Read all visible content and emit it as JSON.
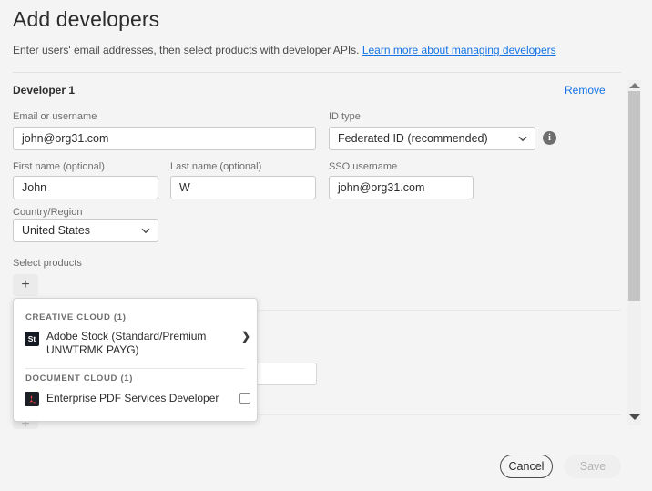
{
  "page": {
    "title": "Add developers",
    "subtitle_text": "Enter users' email addresses, then select products with developer APIs.",
    "subtitle_link": "Learn more about managing developers"
  },
  "developer": {
    "section_label": "Developer 1",
    "remove_label": "Remove"
  },
  "fields": {
    "email": {
      "label": "Email or username",
      "value": "john@org31.com",
      "placeholder": ""
    },
    "id_type": {
      "label": "ID type",
      "value": "Federated ID (recommended)",
      "options": [
        "Federated ID (recommended)"
      ]
    },
    "first_name": {
      "label": "First name (optional)",
      "value": "John",
      "placeholder": ""
    },
    "last_name": {
      "label": "Last name (optional)",
      "value": "W",
      "placeholder": ""
    },
    "sso_username": {
      "label": "SSO username",
      "value": "john@org31.com",
      "placeholder": ""
    },
    "country": {
      "label": "Country/Region",
      "value": "United States",
      "options": [
        "United States"
      ]
    },
    "select_products": {
      "label": "Select products",
      "add_button": "+"
    }
  },
  "icons": {
    "info": "i",
    "chevron_down": "chevron-down-icon",
    "chevron_right": "❯",
    "adobe_stock": "St",
    "acrobat": "A"
  },
  "product_popup": {
    "groups": [
      {
        "heading": "CREATIVE CLOUD (1)",
        "items": [
          {
            "name": "Adobe Stock (Standard/Premium UNWTRMK PAYG)",
            "icon_label": "St",
            "icon_color": "#141922",
            "trailing": "arrow"
          }
        ]
      },
      {
        "heading": "DOCUMENT CLOUD (1)",
        "items": [
          {
            "name": "Enterprise PDF Services Developer",
            "icon_label": "A",
            "icon_color": "#1c1f26",
            "trailing": "checkbox"
          }
        ]
      }
    ]
  },
  "footer": {
    "cancel_label": "Cancel",
    "save_label": "Save"
  },
  "scrollbar": {
    "up_arrow": "scroll-up",
    "down_arrow": "scroll-down"
  },
  "colors": {
    "link": "#1473e6",
    "page_bg": "#f4f4f4",
    "text": "#2c2c2c",
    "muted": "#6e6e6e"
  }
}
